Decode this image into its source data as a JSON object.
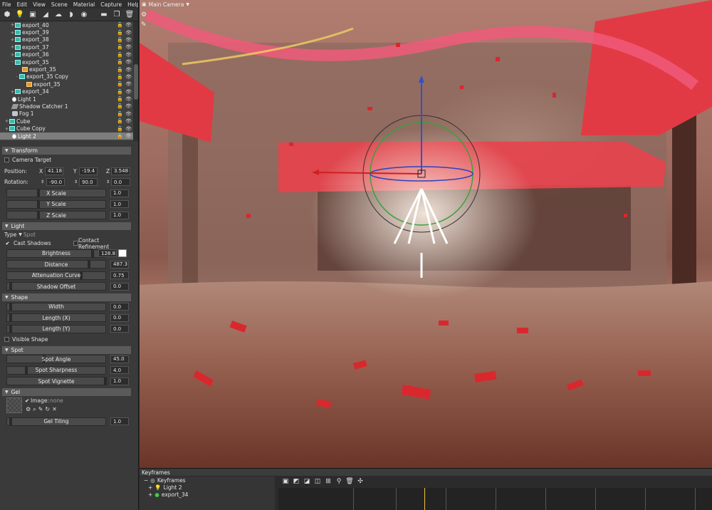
{
  "menu": [
    "File",
    "Edit",
    "View",
    "Scene",
    "Material",
    "Capture",
    "Help"
  ],
  "toolbar_icons": [
    "camera-cube-icon",
    "light-bulb-icon",
    "camera-icon",
    "plane-icon",
    "shadow-icon",
    "fog-icon",
    "sphere-icon",
    "folder-icon",
    "duplicate-icon",
    "trash-icon"
  ],
  "tree": [
    {
      "label": "export_40",
      "icon": "cube",
      "indent": 14,
      "exp": "+"
    },
    {
      "label": "export_39",
      "icon": "cube",
      "indent": 14,
      "exp": "+"
    },
    {
      "label": "export_38",
      "icon": "cube",
      "indent": 14,
      "exp": "+"
    },
    {
      "label": "export_37",
      "icon": "cube",
      "indent": 14,
      "exp": "+"
    },
    {
      "label": "export_36",
      "icon": "cube",
      "indent": 14,
      "exp": "+"
    },
    {
      "label": "export_35",
      "icon": "cube",
      "indent": 14,
      "exp": "-"
    },
    {
      "label": "export_35",
      "icon": "cube-orange",
      "indent": 24,
      "exp": ""
    },
    {
      "label": "export_35 Copy",
      "icon": "cube",
      "indent": 20,
      "exp": "-"
    },
    {
      "label": "export_35",
      "icon": "cube-orange",
      "indent": 30,
      "exp": ""
    },
    {
      "label": "export_34",
      "icon": "cube",
      "indent": 14,
      "exp": "+"
    },
    {
      "label": "Light 1",
      "icon": "bulb",
      "indent": 10,
      "exp": ""
    },
    {
      "label": "Shadow Catcher 1",
      "icon": "shadowc",
      "indent": 10,
      "exp": ""
    },
    {
      "label": "Fog 1",
      "icon": "fog",
      "indent": 10,
      "exp": ""
    },
    {
      "label": "Cube",
      "icon": "cube",
      "indent": 6,
      "exp": "+"
    },
    {
      "label": "Cube Copy",
      "icon": "cube",
      "indent": 6,
      "exp": "+"
    },
    {
      "label": "Light 2",
      "icon": "bulb",
      "indent": 10,
      "exp": "",
      "selected": true
    }
  ],
  "transform": {
    "title": "Transform",
    "camera_target": "Camera Target",
    "position_label": "Position:",
    "rotation_label": "Rotation:",
    "x": "X",
    "y": "Y",
    "z": "Z",
    "pos_x": "41.18",
    "pos_y": "-19.4",
    "pos_z": "3.548",
    "rot_x": "-90.0",
    "rot_y": "90.0",
    "rot_z": "0.0",
    "scales": [
      {
        "label": "X Scale",
        "value": "1.0"
      },
      {
        "label": "Y Scale",
        "value": "1.0"
      },
      {
        "label": "Z Scale",
        "value": "1.0"
      }
    ]
  },
  "light": {
    "title": "Light",
    "type_label": "Type",
    "type_value": "Spot",
    "cast_shadows": "Cast Shadows",
    "contact_refinement": "Contact Refinement",
    "sliders": [
      {
        "label": "Brightness",
        "value": "128.8"
      },
      {
        "label": "Distance",
        "value": "487.3"
      },
      {
        "label": "Attenuation Curve",
        "value": "0.75"
      },
      {
        "label": "Shadow Offset",
        "value": "0.0"
      }
    ]
  },
  "shape": {
    "title": "Shape",
    "sliders": [
      {
        "label": "Width",
        "value": "0.0"
      },
      {
        "label": "Length (X)",
        "value": "0.0"
      },
      {
        "label": "Length (Y)",
        "value": "0.0"
      }
    ],
    "visible_shape": "Visible Shape"
  },
  "spot": {
    "title": "Spot",
    "sliders": [
      {
        "label": "Spot Angle",
        "value": "45.0"
      },
      {
        "label": "Spot Sharpness",
        "value": "4.0"
      },
      {
        "label": "Spot Vignette",
        "value": "1.0"
      }
    ]
  },
  "gel": {
    "title": "Gel",
    "image_label": "Image:",
    "image_value": "none",
    "tiling_label": "Gel Tiling",
    "tiling_value": "1.0"
  },
  "viewport": {
    "camera": "Main Camera"
  },
  "keyframes": {
    "title": "Keyframes",
    "root": "Keyframes",
    "items": [
      "Light 2",
      "export_34"
    ]
  },
  "colors": {
    "selection": "#7d7d7d",
    "section_header": "#5a5a5a",
    "panel": "#3a3a3a",
    "tent_red": "#e8404a"
  }
}
